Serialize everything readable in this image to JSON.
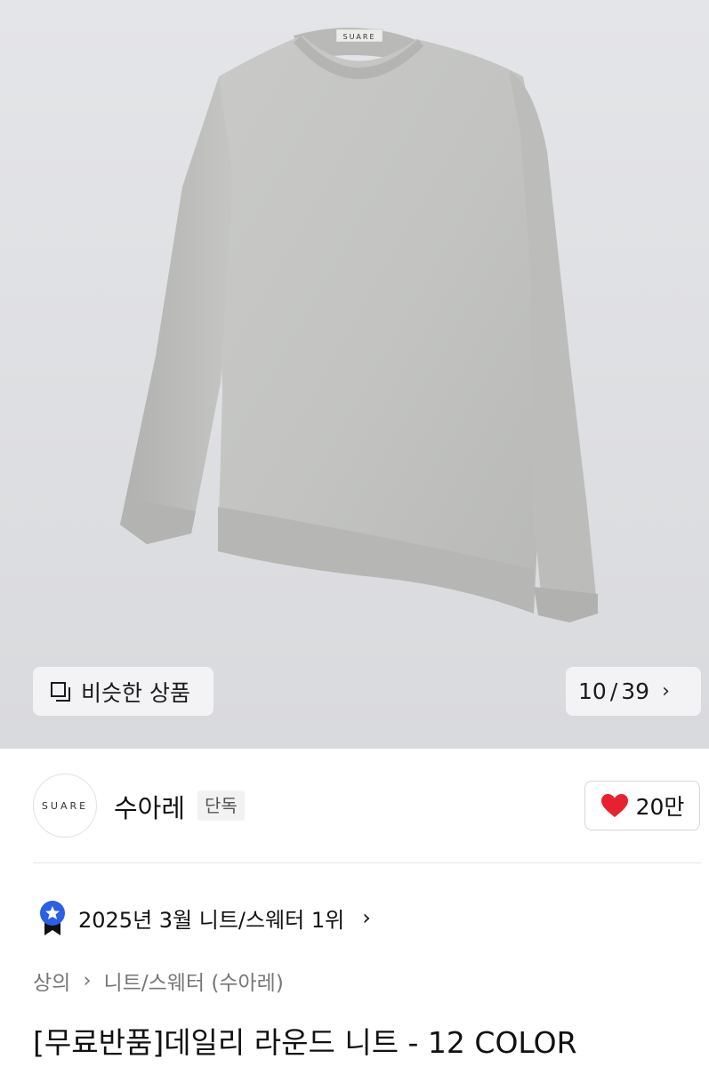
{
  "gallery": {
    "similar_label": "비슷한 상품",
    "counter_current": "10",
    "counter_separator": "/",
    "counter_total": "39",
    "garment_tag": "SUARE"
  },
  "brand": {
    "logo_text": "SUARE",
    "name": "수아레",
    "tag": "단독",
    "like_count": "20만",
    "like_color": "#e8212f"
  },
  "ranking": {
    "text": "2025년 3월 니트/스웨터 1위",
    "badge_color": "#2b5fe8"
  },
  "breadcrumb": {
    "items": [
      "상의",
      "니트/스웨터 (수아레)"
    ]
  },
  "product": {
    "title": "[무료반품]데일리 라운드 니트 - 12 COLOR"
  }
}
